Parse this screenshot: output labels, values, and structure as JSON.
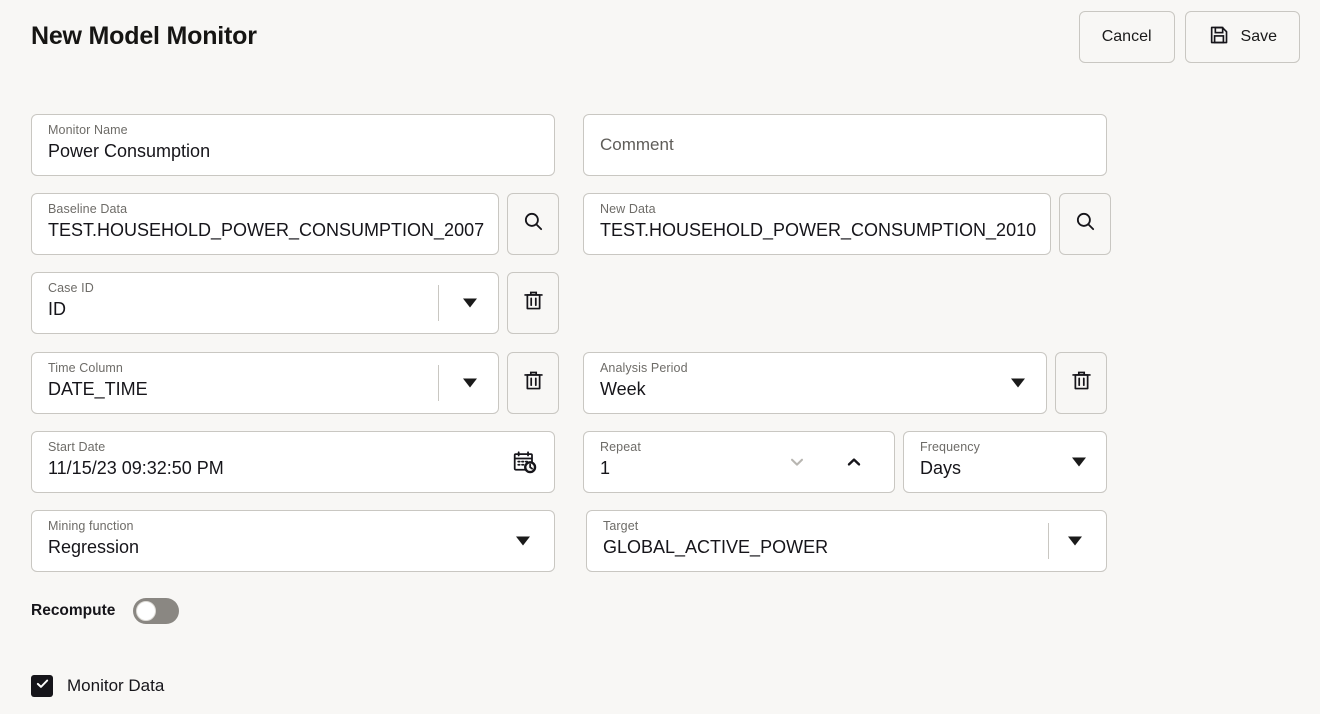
{
  "header": {
    "title": "New Model Monitor",
    "cancel_label": "Cancel",
    "save_label": "Save",
    "save_icon": "floppy-disk-icon"
  },
  "form": {
    "monitor_name": {
      "label": "Monitor Name",
      "value": "Power Consumption"
    },
    "comment": {
      "placeholder": "Comment",
      "value": ""
    },
    "baseline_data": {
      "label": "Baseline Data",
      "value": "TEST.HOUSEHOLD_POWER_CONSUMPTION_2007",
      "button_icon": "search-icon"
    },
    "new_data": {
      "label": "New Data",
      "value": "TEST.HOUSEHOLD_POWER_CONSUMPTION_2010",
      "button_icon": "search-icon"
    },
    "case_id": {
      "label": "Case ID",
      "value": "ID",
      "dropdown_icon": "caret-down-icon",
      "delete_icon": "trash-icon"
    },
    "time_column": {
      "label": "Time Column",
      "value": "DATE_TIME",
      "dropdown_icon": "caret-down-icon",
      "delete_icon": "trash-icon"
    },
    "analysis_period": {
      "label": "Analysis Period",
      "value": "Week",
      "dropdown_icon": "caret-down-icon",
      "delete_icon": "trash-icon"
    },
    "start_date": {
      "label": "Start Date",
      "value": "11/15/23 09:32:50 PM",
      "icon": "calendar-clock-icon"
    },
    "repeat": {
      "label": "Repeat",
      "value": "1",
      "decrement_icon": "chevron-down-icon",
      "increment_icon": "chevron-up-icon"
    },
    "frequency": {
      "label": "Frequency",
      "value": "Days",
      "dropdown_icon": "caret-down-icon"
    },
    "mining_function": {
      "label": "Mining function",
      "value": "Regression",
      "dropdown_icon": "caret-down-icon"
    },
    "target": {
      "label": "Target",
      "value": "GLOBAL_ACTIVE_POWER",
      "dropdown_icon": "caret-down-icon"
    },
    "recompute": {
      "label": "Recompute",
      "state": "off"
    },
    "monitor_data": {
      "label": "Monitor Data",
      "state": "checked",
      "check_icon": "checkmark-icon"
    }
  },
  "colors": {
    "page_background": "#f8f7f5",
    "field_background": "#ffffff",
    "border": "#c9c7c2",
    "label_text": "#6e6c68",
    "value_text": "#16151a",
    "toggle_track_off": "#8a8782",
    "checkbox_checked": "#16151a",
    "stepper_disabled": "#b8b6b1"
  }
}
